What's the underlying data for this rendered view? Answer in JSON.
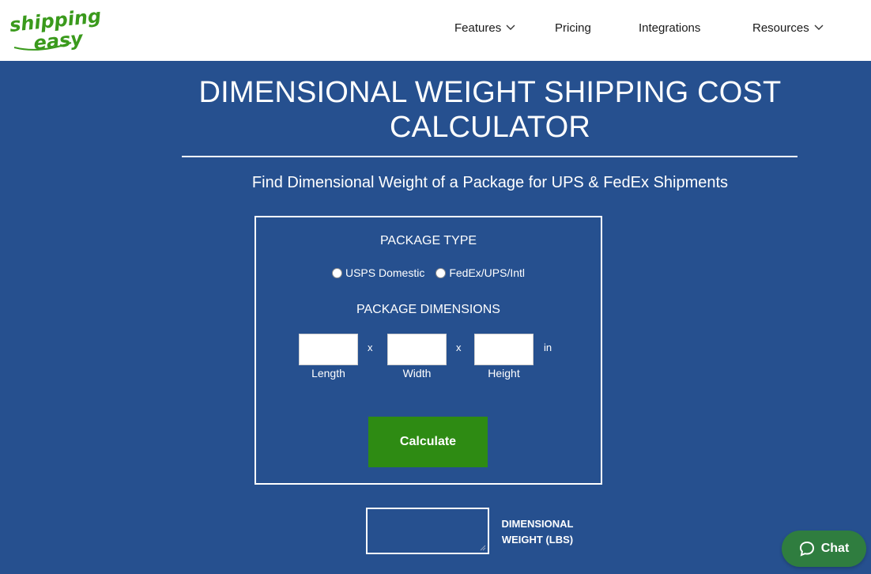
{
  "brand": {
    "logo_line1": "shipping",
    "logo_line2": "easy",
    "logo_color": "#3a9a1c"
  },
  "nav": {
    "items": [
      {
        "label": "Features",
        "has_dropdown": true
      },
      {
        "label": "Pricing",
        "has_dropdown": false
      },
      {
        "label": "Integrations",
        "has_dropdown": false
      },
      {
        "label": "Resources",
        "has_dropdown": true
      }
    ]
  },
  "page": {
    "title": "DIMENSIONAL WEIGHT SHIPPING COST CALCULATOR",
    "subtitle": "Find Dimensional Weight of a Package for UPS & FedEx Shipments",
    "background_color": "#26508f"
  },
  "calculator": {
    "package_type_label": "PACKAGE TYPE",
    "package_type_options": [
      "USPS Domestic",
      "FedEx/UPS/Intl"
    ],
    "dimensions_label": "PACKAGE DIMENSIONS",
    "separator": "x",
    "unit": "in",
    "fields": {
      "length": {
        "label": "Length",
        "value": ""
      },
      "width": {
        "label": "Width",
        "value": ""
      },
      "height": {
        "label": "Height",
        "value": ""
      }
    },
    "button_label": "Calculate",
    "button_color": "#2e8b13"
  },
  "result": {
    "label": "DIMENSIONAL WEIGHT (LBS)",
    "value": ""
  },
  "chat": {
    "label": "Chat",
    "color": "#2f7d3f",
    "icon": "chat-bubble-icon"
  }
}
